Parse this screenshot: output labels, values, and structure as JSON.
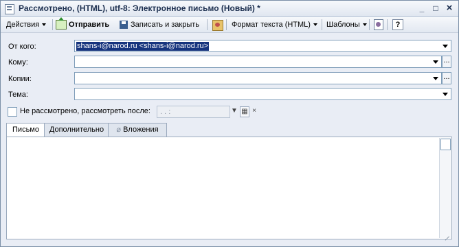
{
  "window": {
    "title": "Рассмотрено,  (HTML), utf-8: Электронное письмо (Новый) *",
    "minimize_glyph": "_",
    "maximize_glyph": "□",
    "close_glyph": "×"
  },
  "toolbar": {
    "actions_label": "Действия",
    "send_label": "Отправить",
    "save_close_label": "Записать и закрыть",
    "text_format_label": "Формат текста (HTML)",
    "templates_label": "Шаблоны",
    "help_label": "?"
  },
  "form": {
    "from_label": "От кого:",
    "from_value": "shans-i@narod.ru <shans-i@narod.ru>",
    "to_label": "Кому:",
    "to_value": "",
    "copies_label": "Копии:",
    "copies_value": "",
    "subject_label": "Тема:",
    "subject_value": "",
    "reviewed_label": "Не рассмотрено, рассмотреть после:",
    "reviewed_date_value": " .  .     :",
    "ellipsis": "..."
  },
  "tabs": [
    {
      "label": "Письмо",
      "active": true
    },
    {
      "label": "Дополнительно",
      "active": false
    },
    {
      "label": "Вложения",
      "active": false
    }
  ],
  "icons": {
    "actions": "dropdown-arrow-icon",
    "send": "send-icon",
    "save": "floppy-disk-icon",
    "address_book": "address-book-icon",
    "document": "document-icon",
    "help": "help-icon",
    "attachment": "paperclip-icon"
  }
}
